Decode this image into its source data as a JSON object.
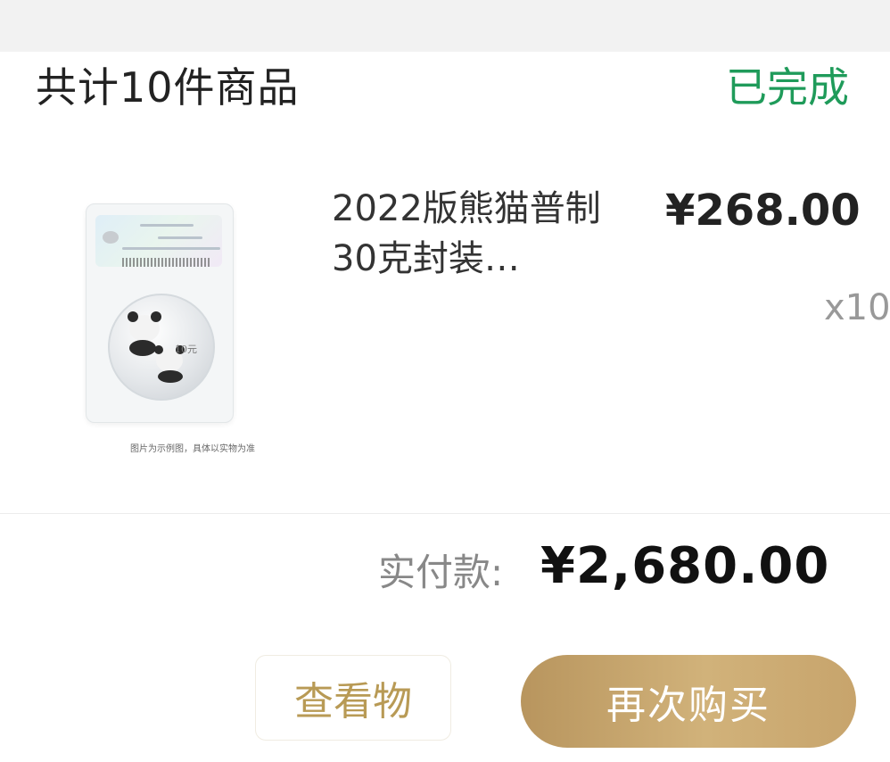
{
  "order": {
    "item_count_label": "共计10件商品",
    "status": "已完成",
    "status_color": "#1f9b5a"
  },
  "product": {
    "image_name": "panda-coin-thumbnail",
    "image_caption": "图片为示例图，具体以实物为准",
    "coin_denomination": "10元",
    "title": "2022版熊猫普制30克封装…",
    "unit_price": "¥268.00",
    "quantity": "x10"
  },
  "payment": {
    "label": "实付款:",
    "amount": "¥2,680.00"
  },
  "actions": {
    "view_logistics_label": "查看物",
    "buy_again_label": "再次购买",
    "accent_color": "#c7a46c"
  }
}
